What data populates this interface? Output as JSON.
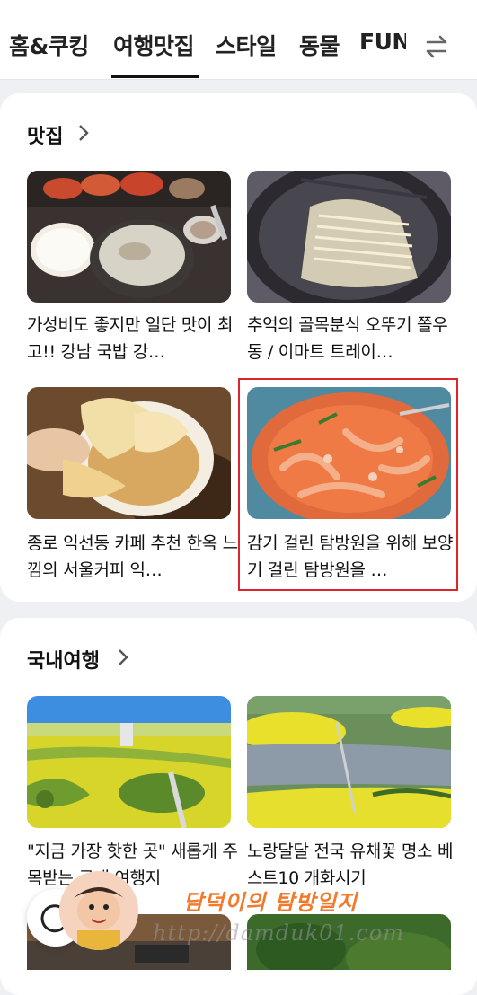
{
  "tabs": [
    {
      "label": "홈&쿠킹",
      "active": false
    },
    {
      "label": "여행맛집",
      "active": true
    },
    {
      "label": "스타일",
      "active": false
    },
    {
      "label": "동물",
      "active": false
    },
    {
      "label": "FUN",
      "active": false
    }
  ],
  "sections": [
    {
      "title": "맛집",
      "items": [
        {
          "caption": "가성비도 좋지만 일단 맛이 최고!! 강남 국밥 강…",
          "image": "korean-soup-meal"
        },
        {
          "caption": "추억의 골목분식 오뚜기 쫄우동 / 이마트 트레이…",
          "image": "noodles-in-pot"
        },
        {
          "caption": "종로 익선동 카페 추천 한옥 느낌의 서울커피 익…",
          "image": "bread-and-dip"
        },
        {
          "caption": "감기 걸린 탐방원을 위해 보양기 걸린 탐방원을 …",
          "image": "spicy-octopus",
          "highlighted": true
        }
      ]
    },
    {
      "title": "국내여행",
      "items": [
        {
          "caption": "\"지금 가장 핫한 곳\" 새롭게 주목받는 국내 여행지",
          "image": "canola-field-aerial"
        },
        {
          "caption": "노랑달달 전국 유채꽃 명소 베스트10 개화시기",
          "image": "canola-river-island"
        }
      ]
    }
  ],
  "watermark": {
    "title": "담덕이의 탐방일지",
    "url": "http://damduk01.com"
  },
  "colors": {
    "highlight": "#e0242b",
    "watermark_title": "#f07b2e"
  }
}
